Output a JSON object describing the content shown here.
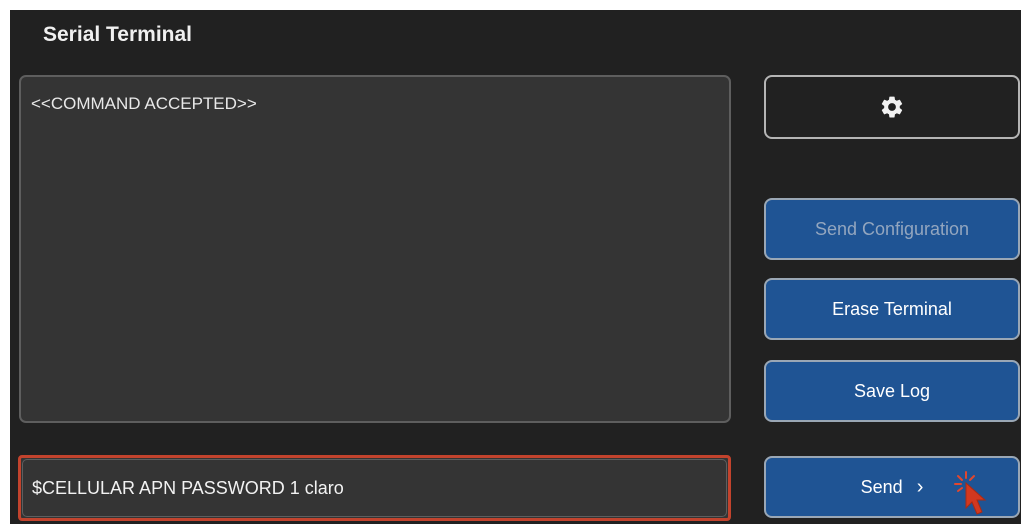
{
  "window": {
    "title": "Serial Terminal"
  },
  "terminal": {
    "lines": [
      "<<COMMAND ACCEPTED>>"
    ]
  },
  "command_input": {
    "value": "$CELLULAR APN PASSWORD 1 claro"
  },
  "buttons": {
    "settings_icon": "gear-icon",
    "send_configuration": "Send Configuration",
    "erase_terminal": "Erase Terminal",
    "save_log": "Save Log",
    "send": "Send",
    "send_chevron": "›"
  },
  "colors": {
    "accent_blue": "#1f5494",
    "highlight_red": "#c2432d",
    "background": "#212121"
  }
}
